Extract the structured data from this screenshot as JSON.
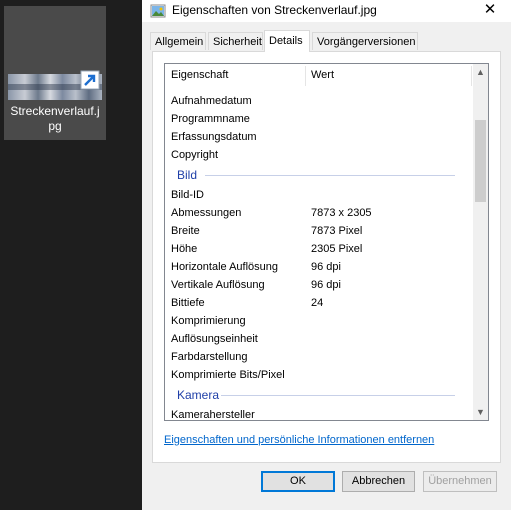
{
  "desktop": {
    "file_label": "Streckenverlauf.jpg",
    "label_line1": "Streckenverlauf.j",
    "label_line2": "pg"
  },
  "dialog": {
    "title": "Eigenschaften von Streckenverlauf.jpg",
    "close_glyph": "✕",
    "tabs": [
      "Allgemein",
      "Sicherheit",
      "Details",
      "Vorgängerversionen"
    ],
    "active_tab": "Details",
    "columns": {
      "property": "Eigenschaft",
      "value": "Wert"
    },
    "rows": [
      {
        "k": "Aufnahmedatum",
        "v": ""
      },
      {
        "k": "Programmname",
        "v": ""
      },
      {
        "k": "Erfassungsdatum",
        "v": ""
      },
      {
        "k": "Copyright",
        "v": ""
      }
    ],
    "group_bild": "Bild",
    "bild_rows": [
      {
        "k": "Bild-ID",
        "v": ""
      },
      {
        "k": "Abmessungen",
        "v": "7873 x 2305"
      },
      {
        "k": "Breite",
        "v": "7873 Pixel"
      },
      {
        "k": "Höhe",
        "v": "2305 Pixel"
      },
      {
        "k": "Horizontale Auflösung",
        "v": "96 dpi"
      },
      {
        "k": "Vertikale Auflösung",
        "v": "96 dpi"
      },
      {
        "k": "Bittiefe",
        "v": "24"
      },
      {
        "k": "Komprimierung",
        "v": ""
      },
      {
        "k": "Auflösungseinheit",
        "v": ""
      },
      {
        "k": "Farbdarstellung",
        "v": ""
      },
      {
        "k": "Komprimierte Bits/Pixel",
        "v": ""
      }
    ],
    "group_kamera": "Kamera",
    "kamera_rows": [
      {
        "k": "Kamerahersteller",
        "v": ""
      }
    ],
    "remove_link": "Eigenschaften und persönliche Informationen entfernen",
    "buttons": {
      "ok": "OK",
      "cancel": "Abbrechen",
      "apply": "Übernehmen"
    },
    "colors": {
      "accent": "#0078d7",
      "group_heading": "#1f3fa8",
      "link": "#0066cc"
    }
  }
}
